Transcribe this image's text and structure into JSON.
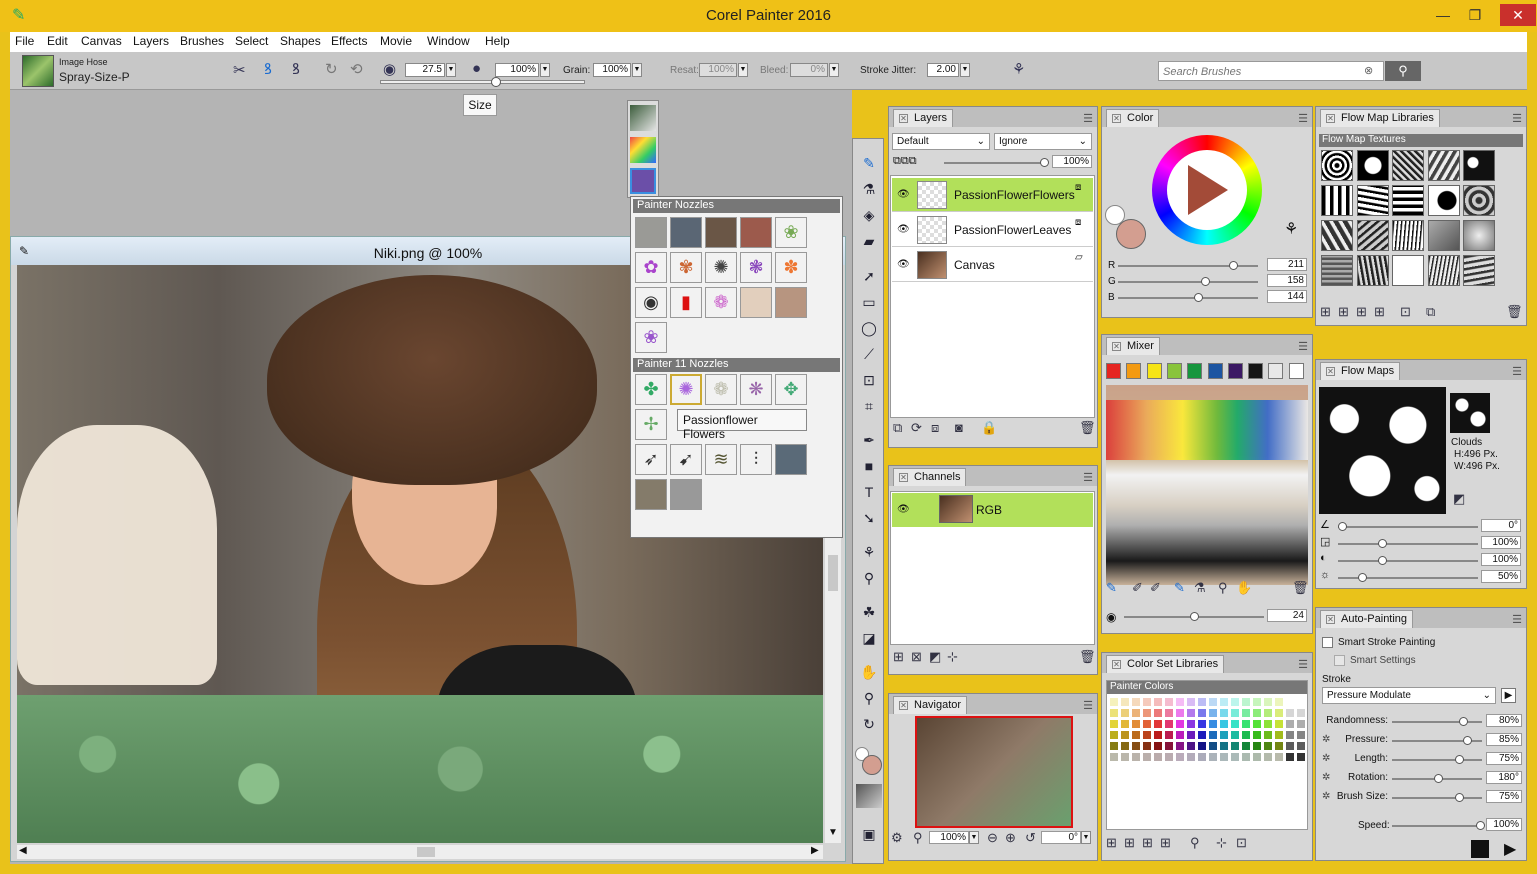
{
  "app": {
    "title": "Corel Painter 2016"
  },
  "menu": [
    "File",
    "Edit",
    "Canvas",
    "Layers",
    "Brushes",
    "Select",
    "Shapes",
    "Effects",
    "Movie",
    "Window",
    "Help"
  ],
  "brush": {
    "category": "Image Hose",
    "variant": "Spray-Size-P"
  },
  "props": {
    "size": "27.5",
    "opacity": "100%",
    "grain_label": "Grain:",
    "grain": "100%",
    "resat_label": "Resat:",
    "resat": "100%",
    "bleed_label": "Bleed:",
    "bleed": "0%",
    "jitter_label": "Stroke Jitter:",
    "jitter": "2.00",
    "tooltip": "Size",
    "size_level": 0.55
  },
  "search": {
    "placeholder": "Search Brushes"
  },
  "document": {
    "title": "Niki.png @ 100%"
  },
  "nozzles": {
    "group1_title": "Painter Nozzles",
    "group2_title": "Painter 11 Nozzles",
    "tooltip": "Passionflower Flowers"
  },
  "layers": {
    "tab": "Layers",
    "composite": "Default",
    "method": "Ignore",
    "opacity": "100%",
    "items": [
      "PassionFlowerFlowers",
      "PassionFlowerLeaves",
      "Canvas"
    ]
  },
  "channels": {
    "tab": "Channels",
    "items": [
      "RGB"
    ]
  },
  "navigator": {
    "tab": "Navigator",
    "zoom": "100%",
    "rotation": "0°"
  },
  "color": {
    "tab": "Color",
    "r": "211",
    "g": "158",
    "b": "144",
    "r_label": "R",
    "g_label": "G",
    "b_label": "B",
    "current": "#d39e90"
  },
  "mixer": {
    "tab": "Mixer",
    "size": "24",
    "swatches": [
      "#e52521",
      "#f39a12",
      "#f6e415",
      "#89c43b",
      "#16963e",
      "#1c55a2",
      "#3b1864",
      "#141414",
      "#e8e8e8",
      "#ffffff"
    ]
  },
  "colorset": {
    "tab": "Color Set Libraries",
    "name": "Painter Colors"
  },
  "flowlib": {
    "tab": "Flow Map Libraries",
    "subtitle": "Flow Map Textures"
  },
  "flowmaps": {
    "tab": "Flow Maps",
    "name": "Clouds",
    "height": "H:496 Px.",
    "width": "W:496 Px.",
    "sliders": [
      "0°",
      "100%",
      "100%",
      "50%"
    ]
  },
  "autopaint": {
    "tab": "Auto-Painting",
    "smart_stroke": "Smart Stroke Painting",
    "smart_settings": "Smart Settings",
    "stroke_label": "Stroke",
    "stroke": "Pressure Modulate",
    "params": [
      {
        "label": "Randomness:",
        "value": "80%"
      },
      {
        "label": "Pressure:",
        "value": "85%"
      },
      {
        "label": "Length:",
        "value": "75%"
      },
      {
        "label": "Rotation:",
        "value": "180°"
      },
      {
        "label": "Brush Size:",
        "value": "75%"
      }
    ],
    "speed_label": "Speed:",
    "speed": "100%"
  }
}
